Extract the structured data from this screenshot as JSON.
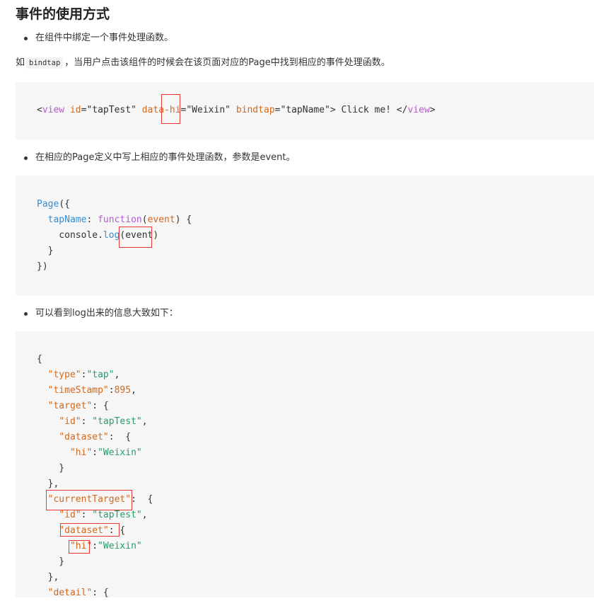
{
  "heading": "事件的使用方式",
  "bullets": {
    "b1": "在组件中绑定一个事件处理函数。",
    "b2": "在相应的Page定义中写上相应的事件处理函数，参数是event。",
    "b3": "可以看到log出来的信息大致如下："
  },
  "para": {
    "prefix": "如",
    "code": "bindtap",
    "suffix": "，当用户点击该组件的时候会在该页面对应的Page中找到相应的事件处理函数。"
  },
  "code1": {
    "open": "<",
    "tag": "view",
    "sp1": " ",
    "attr_id": "id",
    "eq1": "=",
    "val_id": "\"tapTest\"",
    "sp2": " ",
    "attr_data": "data-hi",
    "eq2": "=",
    "val_data": "\"Weixin\"",
    "sp3": " ",
    "attr_bind": "bindtap",
    "eq3": "=",
    "val_bind": "\"tapName\"",
    "text": "> Click me! </",
    "tag_close": "view",
    "close": ">"
  },
  "code2": {
    "l1_page": "Page",
    "l1_rest": "({",
    "l2_indent": "  ",
    "l2_key": "tapName",
    "l2_colon": ": ",
    "l2_fn": "function",
    "l2_paren": "(",
    "l2_param": "event",
    "l2_rest": ") {",
    "l3_pre": "    console.",
    "l3_log": "log",
    "l3_rest": "(event)",
    "l4": "  }",
    "l5": "})"
  },
  "code3": {
    "l1": "{",
    "type_key": "\"type\"",
    "type_val": "\"tap\"",
    "ts_key": "\"timeStamp\"",
    "ts_val": "895",
    "target_key": "\"target\"",
    "id_key": "\"id\"",
    "id_val": "\"tapTest\"",
    "dataset_key": "\"dataset\"",
    "hi_key": "\"hi\"",
    "hi_val": "\"Weixin\"",
    "current_key": "\"currentTarget\"",
    "detail_key": "\"detail\""
  }
}
